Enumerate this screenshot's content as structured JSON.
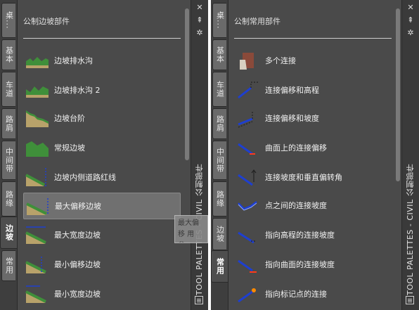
{
  "left_palette": {
    "tabs": [
      "桌...",
      "基本",
      "车道",
      "路肩",
      "中间带",
      "路缘",
      "边坡",
      "常用"
    ],
    "active_tab": "边坡",
    "group_title": "公制边坡部件",
    "tools": [
      {
        "label": "边坡排水沟",
        "icon": "green-slope-ditch-icon"
      },
      {
        "label": "边坡排水沟 2",
        "icon": "green-slope-ditch-icon"
      },
      {
        "label": "边坡台阶",
        "icon": "green-slope-bench-icon"
      },
      {
        "label": "常规边坡",
        "icon": "green-slope-icon"
      },
      {
        "label": "边坡内侧道路红线",
        "icon": "slope-row-line-icon"
      },
      {
        "label": "最大偏移边坡",
        "icon": "slope-max-offset-icon"
      },
      {
        "label": "最大宽度边坡",
        "icon": "slope-max-width-icon"
      },
      {
        "label": "最小偏移边坡",
        "icon": "slope-min-offset-icon"
      },
      {
        "label": "最小宽度边坡",
        "icon": "slope-min-width-icon"
      }
    ],
    "selected_index": 5,
    "title": "TOOL PALETTES - CIVIL 公制部件",
    "tooltip": "最大偏移 用参..."
  },
  "right_palette": {
    "tabs": [
      "桌...",
      "基本",
      "车道",
      "路肩",
      "中间带",
      "路缘",
      "边坡",
      "常用"
    ],
    "active_tab": "常用",
    "group_title": "公制常用部件",
    "tools": [
      {
        "label": "多个连接",
        "icon": "multiple-link-icon"
      },
      {
        "label": "连接偏移和高程",
        "icon": "link-offset-elevation-icon"
      },
      {
        "label": "连接偏移和坡度",
        "icon": "link-offset-slope-icon"
      },
      {
        "label": "曲面上的连接偏移",
        "icon": "link-offset-surface-icon"
      },
      {
        "label": "连接坡度和垂直偏转角",
        "icon": "link-slope-vertical-icon"
      },
      {
        "label": "点之间的连接坡度",
        "icon": "link-slope-points-icon"
      },
      {
        "label": "指向高程的连接坡度",
        "icon": "link-slope-elevation-icon"
      },
      {
        "label": "指向曲面的连接坡度",
        "icon": "link-slope-surface-icon"
      },
      {
        "label": "指向标记点的连接",
        "icon": "link-marked-point-icon"
      }
    ],
    "title": "TOOL PALETTES - CIVIL 公制部件"
  },
  "titlebar_buttons": {
    "close": "✕",
    "pin": "⇞",
    "settings": "✲"
  },
  "colors": {
    "slope_green": "#3f8f3a",
    "link_blue": "#1e3fd0",
    "soil": "#b8a26a",
    "accent_orange": "#ff8a00"
  }
}
